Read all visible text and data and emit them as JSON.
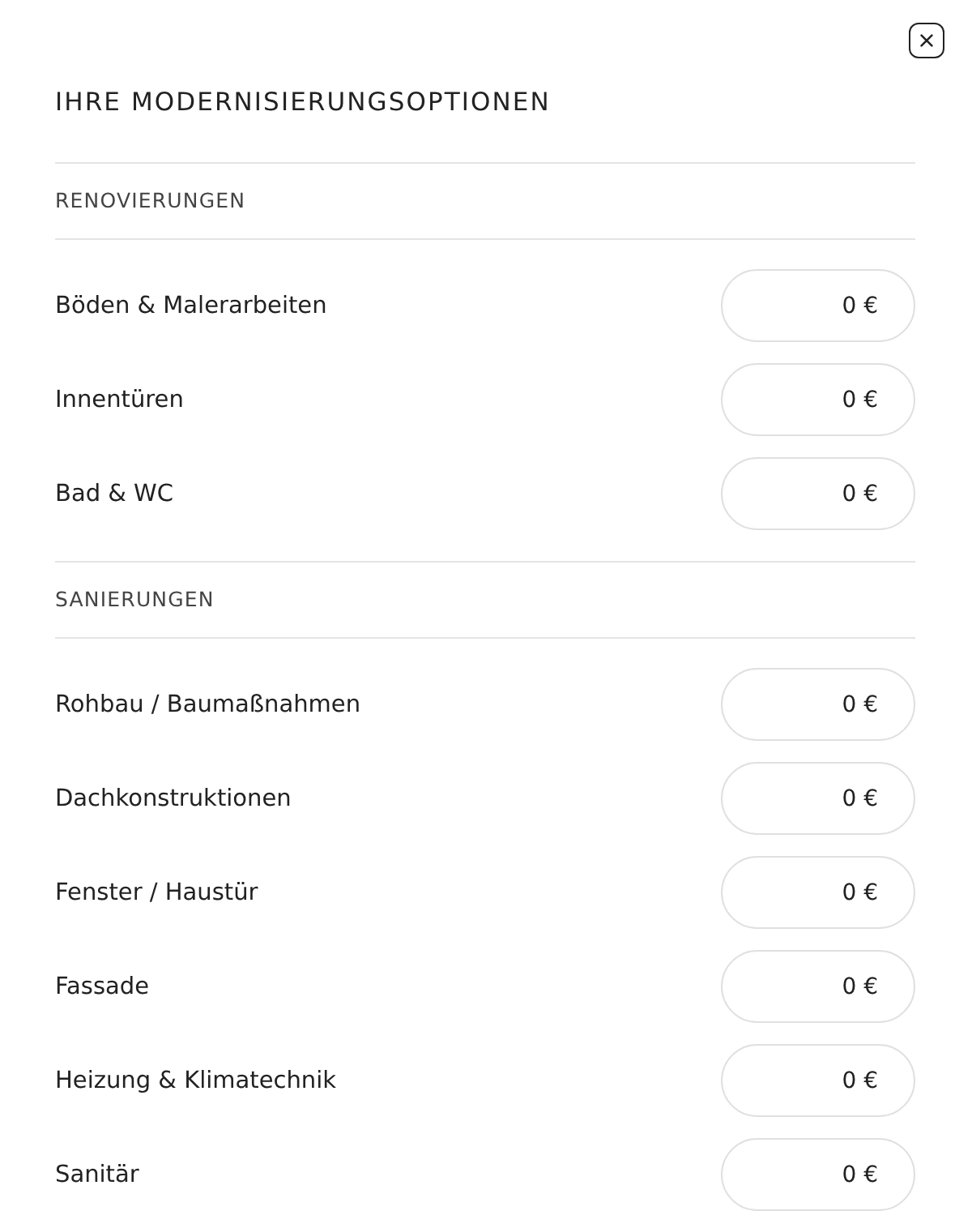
{
  "dialog": {
    "title": "IHRE MODERNISIERUNGSOPTIONEN"
  },
  "sections": [
    {
      "heading": "RENOVIERUNGEN",
      "options": [
        {
          "label": "Böden & Malerarbeiten",
          "value": "0 €"
        },
        {
          "label": "Innentüren",
          "value": "0 €"
        },
        {
          "label": "Bad & WC",
          "value": "0 €"
        }
      ]
    },
    {
      "heading": "SANIERUNGEN",
      "options": [
        {
          "label": "Rohbau / Baumaßnahmen",
          "value": "0 €"
        },
        {
          "label": "Dachkonstruktionen",
          "value": "0 €"
        },
        {
          "label": "Fenster / Haustür",
          "value": "0 €"
        },
        {
          "label": "Fassade",
          "value": "0 €"
        },
        {
          "label": "Heizung & Klimatechnik",
          "value": "0 €"
        },
        {
          "label": "Sanitär",
          "value": "0 €"
        }
      ]
    }
  ]
}
